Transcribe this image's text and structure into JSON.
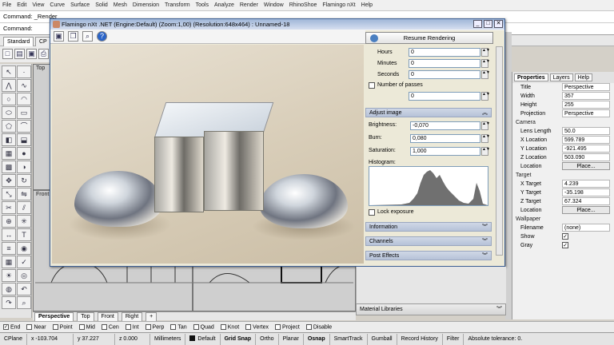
{
  "menu": [
    "File",
    "Edit",
    "View",
    "Curve",
    "Surface",
    "Solid",
    "Mesh",
    "Dimension",
    "Transform",
    "Tools",
    "Analyze",
    "Render",
    "Window",
    "RhinoShoe",
    "Flamingo nXt",
    "Help"
  ],
  "command_history": "Command: _Render",
  "command_prompt": "Command:",
  "toolbar_tabs": [
    "Standard",
    "CP"
  ],
  "viewport_titles": {
    "top": "Top",
    "front": "Front"
  },
  "viewport_tabs": [
    "Perspective",
    "Top",
    "Front",
    "Right"
  ],
  "dialog": {
    "title": "Flamingo nXt .NET (Engine:Default) (Zoom:1,00) (Resolution:648x464) : Unnamed-18",
    "resume_label": "Resume Rendering",
    "hours_label": "Hours",
    "hours_value": "0",
    "minutes_label": "Minutes",
    "minutes_value": "0",
    "seconds_label": "Seconds",
    "seconds_value": "0",
    "passes_label": "Number of passes",
    "passes_value": "0",
    "adjust_image": "Adjust image",
    "brightness_label": "Brightness:",
    "brightness_value": "-0,070",
    "burn_label": "Burn:",
    "burn_value": "0,080",
    "saturation_label": "Saturation:",
    "saturation_value": "1,000",
    "histogram_label": "Histogram:",
    "lock_exposure": "Lock exposure",
    "sections": [
      "Information",
      "Channels",
      "Post Effects"
    ]
  },
  "material_libraries": "Material Libraries",
  "properties": {
    "tabs": [
      "Properties",
      "Layers",
      "Help"
    ],
    "rows": [
      {
        "k": "Title",
        "v": "Perspective"
      },
      {
        "k": "Width",
        "v": "357"
      },
      {
        "k": "Height",
        "v": "255"
      },
      {
        "k": "Projection",
        "v": "Perspective"
      }
    ],
    "camera_group": "Camera",
    "camera_rows": [
      {
        "k": "Lens Length",
        "v": "50.0"
      },
      {
        "k": "X Location",
        "v": "599.789"
      },
      {
        "k": "Y Location",
        "v": "-921.495"
      },
      {
        "k": "Z Location",
        "v": "503.090"
      }
    ],
    "location_label": "Location",
    "place_label": "Place...",
    "target_group": "Target",
    "target_rows": [
      {
        "k": "X Target",
        "v": "4.239"
      },
      {
        "k": "Y Target",
        "v": "-35.198"
      },
      {
        "k": "Z Target",
        "v": "67.324"
      }
    ],
    "wallpaper_group": "Wallpaper",
    "filename_label": "Filename",
    "filename_value": "(none)",
    "show_label": "Show",
    "gray_label": "Gray"
  },
  "osnap": [
    "End",
    "Near",
    "Point",
    "Mid",
    "Cen",
    "Int",
    "Perp",
    "Tan",
    "Quad",
    "Knot",
    "Vertex",
    "Project",
    "Disable"
  ],
  "status": {
    "cplane": "CPlane",
    "x": "x -103.704",
    "y": "y 37.227",
    "z": "z 0.000",
    "units": "Millimeters",
    "layer": "Default",
    "toggles": [
      "Grid Snap",
      "Ortho",
      "Planar",
      "Osnap",
      "SmartTrack",
      "Gumball",
      "Record History",
      "Filter"
    ],
    "tolerance": "Absolute tolerance: 0."
  }
}
